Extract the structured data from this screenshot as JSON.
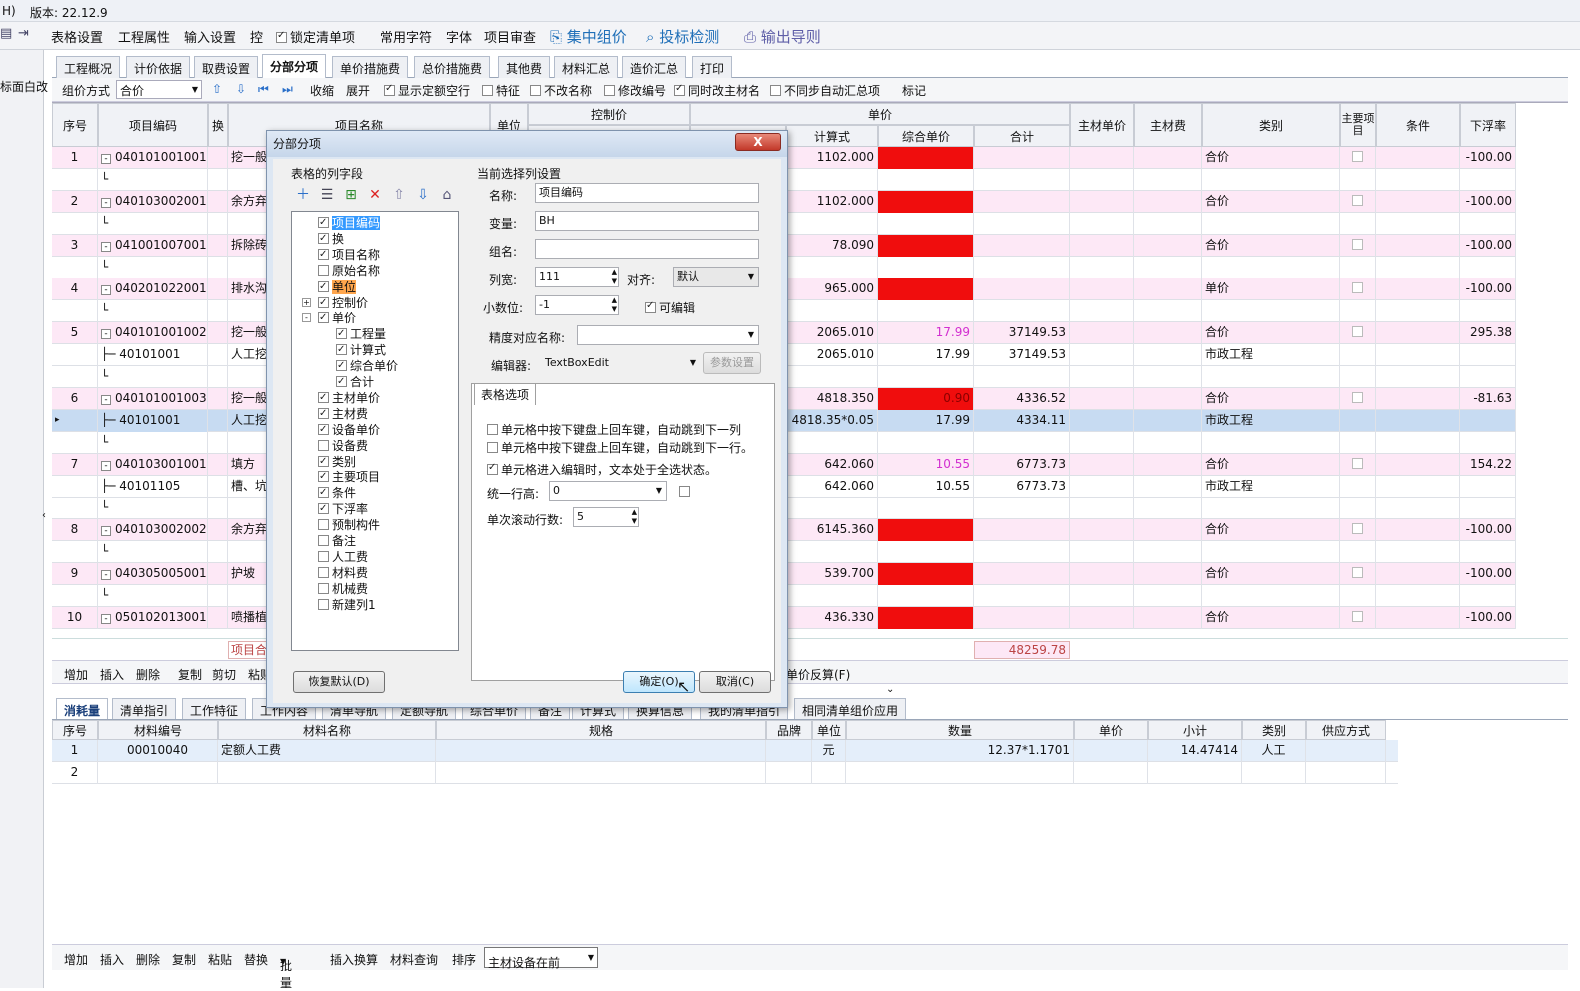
{
  "titlebar": {
    "left": "H)",
    "version": "版本: 22.12.9"
  },
  "menu": {
    "items": [
      "表格设置",
      "工程属性",
      "输入设置",
      "控"
    ],
    "lock_label": "锁定清单项",
    "items2": [
      "常用字符",
      "字体",
      "项目审查"
    ],
    "big1": "集中组价",
    "big2": "投标检测",
    "big3": "输出导则"
  },
  "leftpane": {
    "text": "标面白改"
  },
  "tabs": [
    "工程概况",
    "计价依据",
    "取费设置",
    "分部分项",
    "单价措施费",
    "总价措施费",
    "其他费",
    "材料汇总",
    "造价汇总",
    "打印"
  ],
  "toolbar2": {
    "zujia_label": "组价方式",
    "zujia_value": "合价",
    "shousuo": "收缩",
    "zhankai": "展开",
    "show_quota": "显示定额空行",
    "tezheng": "特征",
    "bugai": "不改名称",
    "xiugai": "修改编号",
    "tongshi": "同时改主材名",
    "butongbu": "不同步自动汇总项",
    "biaoji": "标记"
  },
  "grid": {
    "headers": {
      "seq": "序号",
      "code": "项目编码",
      "huan": "换",
      "name": "项目名称",
      "unit": "单位",
      "kongzhi": "控制价",
      "danjia": "单价",
      "jisuanshi": "计算式",
      "zonghe": "综合单价",
      "heji": "合计",
      "zhucai_dj": "主材单价",
      "zhucai_fei": "主材费",
      "leibie": "类别",
      "zhuyao": "主要项目",
      "tiaojian": "条件",
      "xiafu": "下浮率"
    },
    "rows": [
      {
        "seq": "1",
        "code": "040101001001",
        "name": "挖一般",
        "calc": "1102.000",
        "zonghe": "",
        "heji": "",
        "type": "合价",
        "rate": "-100.00",
        "kind": "main",
        "red": true
      },
      {
        "seq": "",
        "code": "",
        "name": "",
        "calc": "",
        "zonghe": "",
        "heji": "",
        "type": "",
        "rate": "",
        "kind": "blank"
      },
      {
        "seq": "2",
        "code": "040103002001",
        "name": "余方弃",
        "calc": "1102.000",
        "zonghe": "",
        "heji": "",
        "type": "合价",
        "rate": "-100.00",
        "kind": "main",
        "red": true
      },
      {
        "seq": "",
        "code": "",
        "name": "",
        "calc": "",
        "zonghe": "",
        "heji": "",
        "type": "",
        "rate": "",
        "kind": "blank"
      },
      {
        "seq": "3",
        "code": "041001007001",
        "name": "拆除砖",
        "calc": "78.090",
        "zonghe": "",
        "heji": "",
        "type": "合价",
        "rate": "-100.00",
        "kind": "main",
        "red": true
      },
      {
        "seq": "",
        "code": "",
        "name": "",
        "calc": "",
        "zonghe": "",
        "heji": "",
        "type": "",
        "rate": "",
        "kind": "blank"
      },
      {
        "seq": "4",
        "code": "040201022001",
        "name": "排水沟",
        "calc": "965.000",
        "zonghe": "",
        "heji": "",
        "type": "单价",
        "rate": "-100.00",
        "kind": "main",
        "red": true
      },
      {
        "seq": "",
        "code": "",
        "name": "",
        "calc": "",
        "zonghe": "",
        "heji": "",
        "type": "",
        "rate": "",
        "kind": "blank"
      },
      {
        "seq": "5",
        "code": "040101001002",
        "name": "挖一般",
        "calc": "2065.010",
        "zonghe": "17.99",
        "heji": "37149.53",
        "type": "合价",
        "rate": "295.38",
        "kind": "main",
        "pinknum": true
      },
      {
        "seq": "",
        "code": "40101001",
        "name": "人工挖",
        "calc": "2065.010",
        "zonghe": "17.99",
        "heji": "37149.53",
        "type": "市政工程",
        "rate": "",
        "kind": "sub"
      },
      {
        "seq": "",
        "code": "",
        "name": "",
        "calc": "",
        "zonghe": "",
        "heji": "",
        "type": "",
        "rate": "",
        "kind": "blank"
      },
      {
        "seq": "6",
        "code": "040101001003",
        "name": "挖一般",
        "calc": "4818.350",
        "zonghe": "0.90",
        "heji": "4336.52",
        "type": "合价",
        "rate": "-81.63",
        "kind": "main",
        "red": true
      },
      {
        "seq": "",
        "code": "40101001",
        "name": "人工挖",
        "calc": "4818.35*0.05",
        "zonghe": "17.99",
        "heji": "4334.11",
        "type": "市政工程",
        "rate": "",
        "kind": "subsel"
      },
      {
        "seq": "",
        "code": "",
        "name": "",
        "calc": "",
        "zonghe": "",
        "heji": "",
        "type": "",
        "rate": "",
        "kind": "blank"
      },
      {
        "seq": "7",
        "code": "040103001001",
        "name": "填方",
        "calc": "642.060",
        "zonghe": "10.55",
        "heji": "6773.73",
        "type": "合价",
        "rate": "154.22",
        "kind": "main",
        "pinknum": true
      },
      {
        "seq": "",
        "code": "40101105",
        "name": "槽、坑",
        "calc": "642.060",
        "zonghe": "10.55",
        "heji": "6773.73",
        "type": "市政工程",
        "rate": "",
        "kind": "sub"
      },
      {
        "seq": "",
        "code": "",
        "name": "",
        "calc": "",
        "zonghe": "",
        "heji": "",
        "type": "",
        "rate": "",
        "kind": "blank"
      },
      {
        "seq": "8",
        "code": "040103002002",
        "name": "余方弃",
        "calc": "6145.360",
        "zonghe": "",
        "heji": "",
        "type": "合价",
        "rate": "-100.00",
        "kind": "main",
        "red": true
      },
      {
        "seq": "",
        "code": "",
        "name": "",
        "calc": "",
        "zonghe": "",
        "heji": "",
        "type": "",
        "rate": "",
        "kind": "blank"
      },
      {
        "seq": "9",
        "code": "040305005001",
        "name": "护坡",
        "calc": "539.700",
        "zonghe": "",
        "heji": "",
        "type": "合价",
        "rate": "-100.00",
        "kind": "main",
        "red": true
      },
      {
        "seq": "",
        "code": "",
        "name": "",
        "calc": "",
        "zonghe": "",
        "heji": "",
        "type": "",
        "rate": "",
        "kind": "blank"
      },
      {
        "seq": "10",
        "code": "050102013001",
        "name": "喷播植",
        "calc": "436.330",
        "zonghe": "",
        "heji": "",
        "type": "合价",
        "rate": "-100.00",
        "kind": "main",
        "red": true
      }
    ],
    "footer_label": "项目合",
    "footer_total": "48259.78"
  },
  "btnbar": [
    "增加",
    "插入",
    "删除",
    "复制",
    "剪切",
    "粘贴"
  ],
  "btnbar_right": "单价反算(F)",
  "tabs2": [
    "消耗量",
    "清单指引",
    "工作特征",
    "工作内容",
    "清单导航",
    "定额导航",
    "综合单价",
    "备注",
    "计算式",
    "换算信息",
    "我的清单指引",
    "相同清单组价应用"
  ],
  "grid2": {
    "headers": [
      "序号",
      "材料编号",
      "材料名称",
      "规格",
      "品牌",
      "单位",
      "数量",
      "单价",
      "小计",
      "类别",
      "供应方式"
    ],
    "rows": [
      {
        "seq": "1",
        "code": "00010040",
        "name": "定额人工费",
        "spec": "",
        "brand": "",
        "unit": "元",
        "qty": "12.37*1.1701",
        "price": "",
        "subtotal": "14.47414",
        "type": "人工",
        "supply": ""
      },
      {
        "seq": "2",
        "code": "",
        "name": "",
        "spec": "",
        "brand": "",
        "unit": "",
        "qty": "",
        "price": "",
        "subtotal": "",
        "type": "",
        "supply": ""
      }
    ]
  },
  "btnbar2": [
    "增加",
    "插入",
    "删除",
    "复制",
    "粘贴",
    "替换",
    "批量",
    "插入换算",
    "材料查询",
    "排序"
  ],
  "btnbar2_select": "主材设备在前",
  "dialog": {
    "title": "分部分项",
    "close": "X",
    "left_label": "表格的列字段",
    "right_label": "当前选择列设置",
    "tree": [
      {
        "label": "项目编码",
        "checked": true,
        "level": 0,
        "highlight": "blue"
      },
      {
        "label": "换",
        "checked": true,
        "level": 0
      },
      {
        "label": "项目名称",
        "checked": true,
        "level": 0
      },
      {
        "label": "原始名称",
        "checked": false,
        "level": 0
      },
      {
        "label": "单位",
        "checked": true,
        "level": 0,
        "highlight": "orange"
      },
      {
        "label": "控制价",
        "checked": true,
        "level": 0,
        "expander": "+"
      },
      {
        "label": "单价",
        "checked": true,
        "level": 0,
        "expander": "-"
      },
      {
        "label": "工程量",
        "checked": true,
        "level": 1
      },
      {
        "label": "计算式",
        "checked": true,
        "level": 1
      },
      {
        "label": "综合单价",
        "checked": true,
        "level": 1
      },
      {
        "label": "合计",
        "checked": true,
        "level": 1
      },
      {
        "label": "主材单价",
        "checked": true,
        "level": 0
      },
      {
        "label": "主材费",
        "checked": true,
        "level": 0
      },
      {
        "label": "设备单价",
        "checked": true,
        "level": 0
      },
      {
        "label": "设备费",
        "checked": false,
        "level": 0
      },
      {
        "label": "类别",
        "checked": true,
        "level": 0
      },
      {
        "label": "主要项目",
        "checked": true,
        "level": 0
      },
      {
        "label": "条件",
        "checked": true,
        "level": 0
      },
      {
        "label": "下浮率",
        "checked": true,
        "level": 0
      },
      {
        "label": "预制构件",
        "checked": false,
        "level": 0
      },
      {
        "label": "备注",
        "checked": false,
        "level": 0
      },
      {
        "label": "人工费",
        "checked": false,
        "level": 0
      },
      {
        "label": "材料费",
        "checked": false,
        "level": 0
      },
      {
        "label": "机械费",
        "checked": false,
        "level": 0
      },
      {
        "label": "新建列1",
        "checked": false,
        "level": 0
      }
    ],
    "name_label": "名称:",
    "name_value": "项目编码",
    "var_label": "变量:",
    "var_value": "BH",
    "group_label": "组名:",
    "group_value": "",
    "width_label": "列宽:",
    "width_value": "111",
    "align_label": "对齐:",
    "align_value": "默认",
    "decimal_label": "小数位:",
    "decimal_value": "-1",
    "editable_label": "可编辑",
    "precision_label": "精度对应名称:",
    "precision_value": "",
    "editor_label": "编辑器:",
    "editor_value": "TextBoxEdit",
    "param_btn": "参数设置",
    "options_tab": "表格选项",
    "opt1": "单元格中按下键盘上回车键，自动跳到下一列",
    "opt2": "单元格中按下键盘上回车键，自动跳到下一行。",
    "opt3": "单元格进入编辑时，文本处于全选状态。",
    "rowheight_label": "统一行高:",
    "rowheight_value": "0",
    "scroll_label": "单次滚动行数:",
    "scroll_value": "5",
    "restore_btn": "恢复默认(D)",
    "ok_btn": "确定(O)",
    "cancel_btn": "取消(C)"
  },
  "colors": {
    "red": "#f00d0d",
    "pink_row": "#fde8f6",
    "sel_row": "#c7dbf2",
    "accent": "#1f6fb8"
  }
}
